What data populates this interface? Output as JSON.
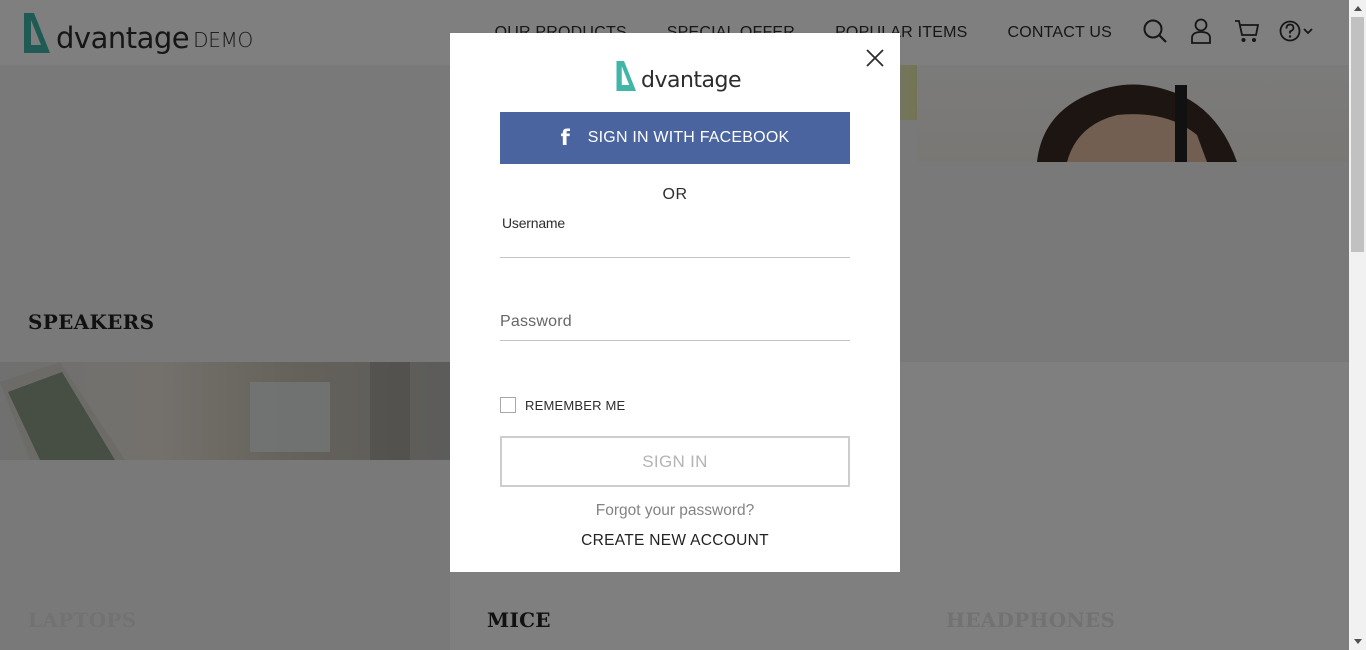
{
  "header": {
    "logo_word": "dvantage",
    "logo_suffix": "DEMO",
    "nav": [
      {
        "label": "OUR PRODUCTS"
      },
      {
        "label": "SPECIAL OFFER"
      },
      {
        "label": "POPULAR ITEMS"
      },
      {
        "label": "CONTACT US"
      }
    ],
    "icons": [
      "search-icon",
      "user-icon",
      "cart-icon",
      "help-icon",
      "chevron-down-icon"
    ]
  },
  "categories": {
    "speakers": "SPEAKERS",
    "laptops": "LAPTOPS",
    "mice": "MICE",
    "headphones": "HEADPHONES"
  },
  "login_modal": {
    "logo_word": "dvantage",
    "facebook_button": "SIGN IN WITH FACEBOOK",
    "facebook_icon": "f",
    "or_text": "OR",
    "username_label": "Username",
    "password_placeholder": "Password",
    "remember_me": "REMEMBER ME",
    "remember_checked": false,
    "sign_in_button": "SIGN IN",
    "forgot_password": "Forgot your password?",
    "create_account": "CREATE NEW ACCOUNT"
  },
  "colors": {
    "accent_teal": "#3fb6a8",
    "facebook_blue": "#4a64a0",
    "overlay": "rgba(0,0,0,0.5)"
  }
}
